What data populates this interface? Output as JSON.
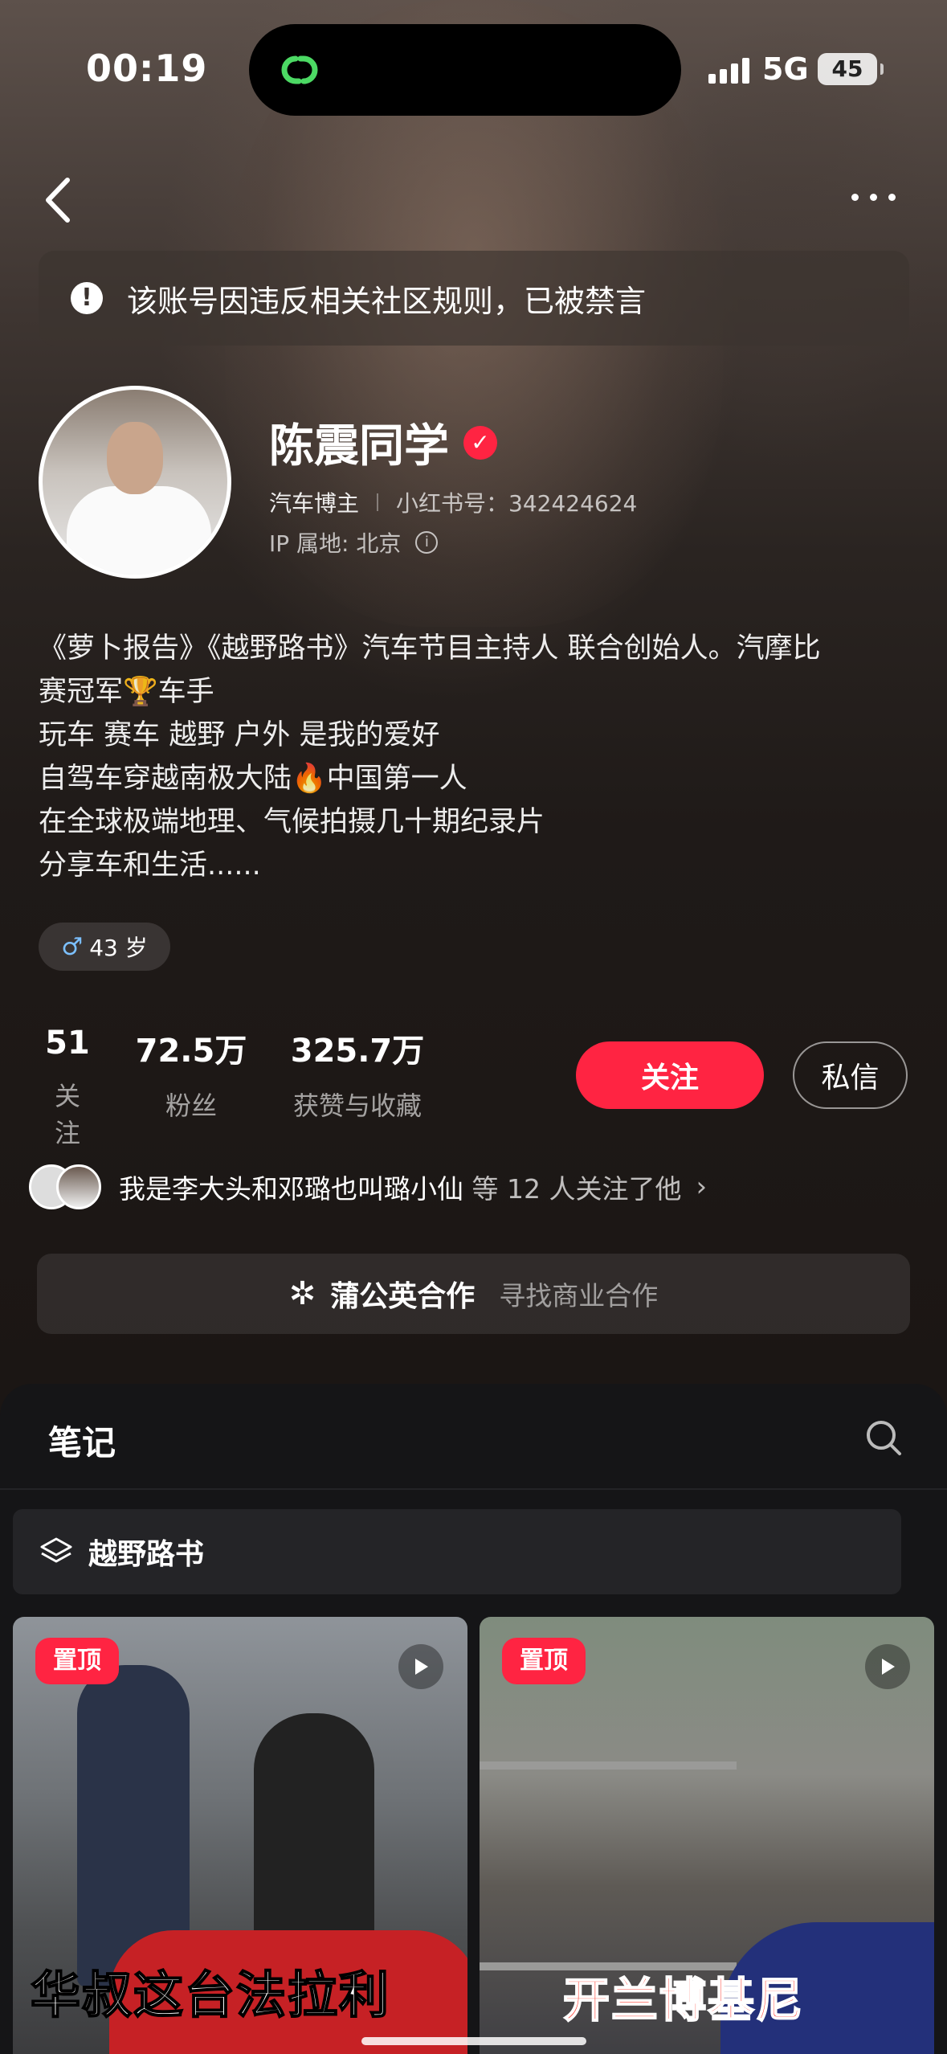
{
  "status_bar": {
    "time": "00:19",
    "network": "5G",
    "battery": "45"
  },
  "notice": {
    "text": "该账号因违反相关社区规则，已被禁言"
  },
  "profile": {
    "name": "陈震同学",
    "tag": "汽车博主",
    "red_id": "小红书号：342424624",
    "ip_location": "IP 属地: 北京",
    "bio_lines": [
      "《萝卜报告》《越野路书》汽车节目主持人 联合创始人。汽摩比",
      "赛冠军🏆车手",
      "玩车 赛车 越野 户外 是我的爱好",
      "自驾车穿越南极大陆🔥中国第一人",
      "在全球极端地理、气候拍摄几十期纪录片",
      "分享车和生活......"
    ],
    "age": "43 岁"
  },
  "stats": {
    "following": {
      "value": "51",
      "label": "关注"
    },
    "followers": {
      "value": "72.5万",
      "label": "粉丝"
    },
    "likes": {
      "value": "325.7万",
      "label": "获赞与收藏"
    }
  },
  "actions": {
    "follow": "关注",
    "message": "私信"
  },
  "mutual": {
    "names": "我是李大头和邓璐也叫璐小仙",
    "suffix": " 等 12 人关注了他"
  },
  "business": {
    "title": "蒲公英合作",
    "subtitle": "寻找商业合作"
  },
  "notes": {
    "tab": "笔记",
    "collection": "越野路书",
    "cards": [
      {
        "badge": "置顶",
        "caption": "华叔这台法拉利"
      },
      {
        "badge": "置顶",
        "caption": "开兰博基尼"
      }
    ]
  },
  "colors": {
    "accent": "#ff2442",
    "background": "#1b1614"
  }
}
